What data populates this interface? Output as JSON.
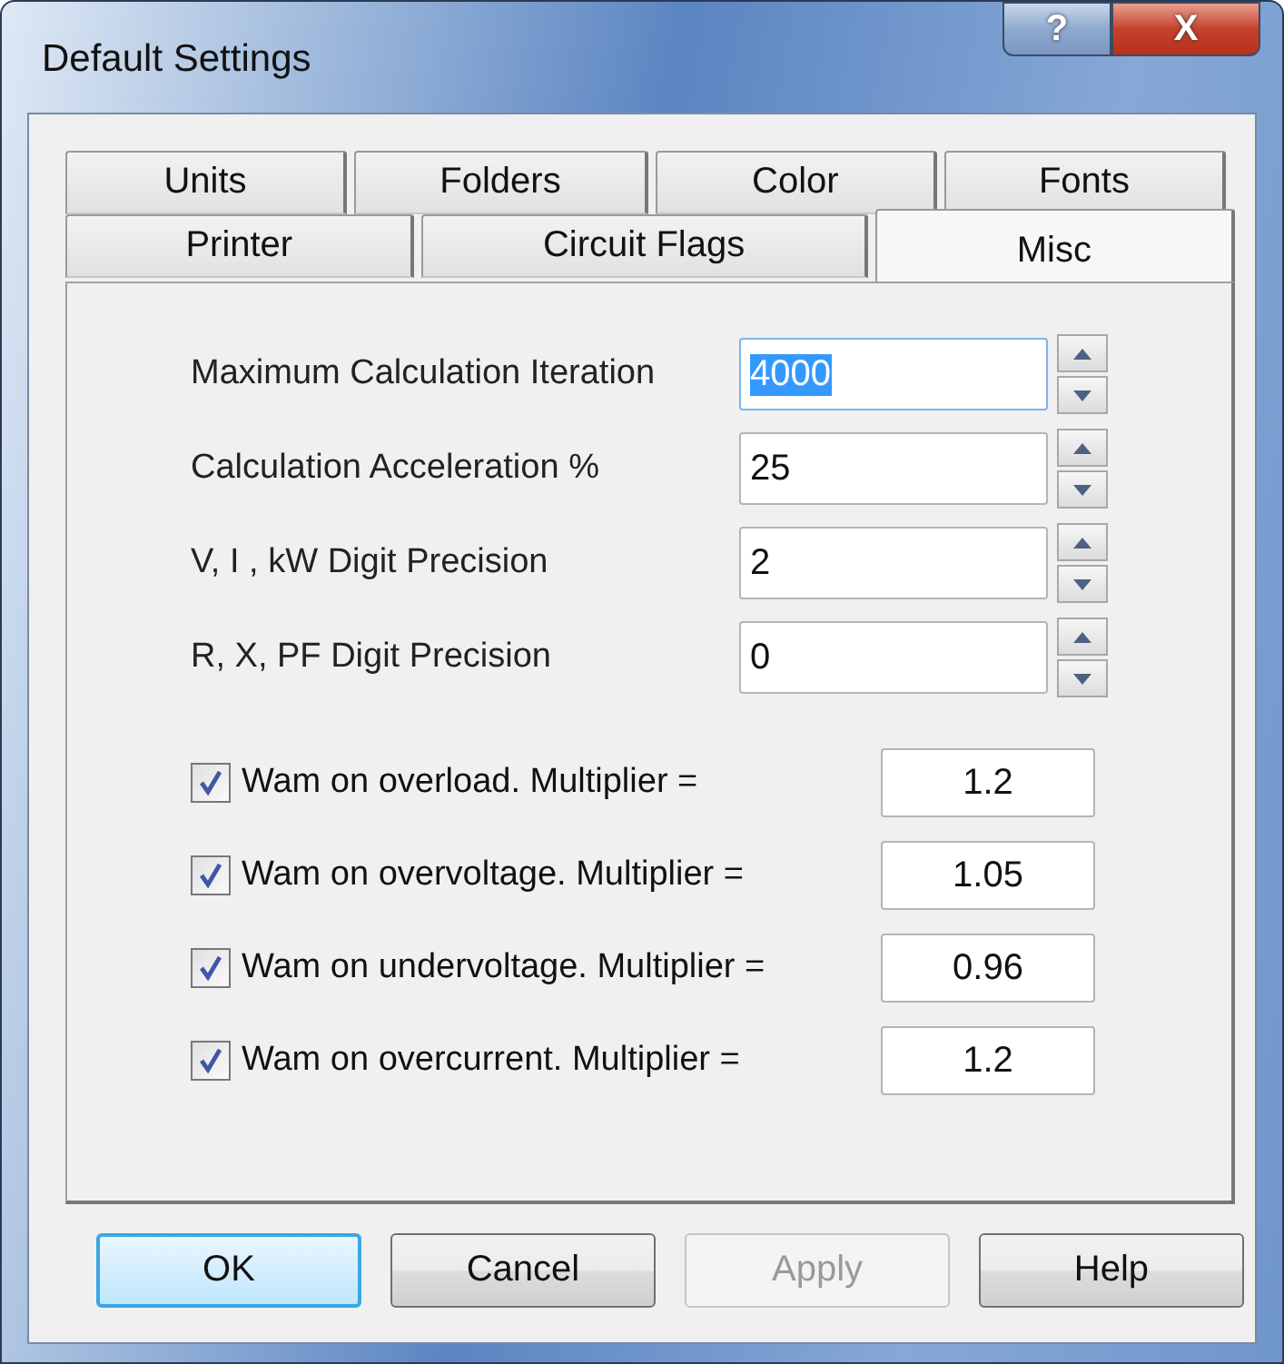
{
  "window": {
    "title": "Default Settings",
    "help_button": "?",
    "close_button": "X"
  },
  "tab_rows": [
    [
      {
        "label": "Units",
        "selected": false
      },
      {
        "label": "Folders",
        "selected": false
      },
      {
        "label": "Color",
        "selected": false
      },
      {
        "label": "Fonts",
        "selected": false
      }
    ],
    [
      {
        "label": "Printer",
        "selected": false
      },
      {
        "label": "Circuit Flags",
        "selected": false
      },
      {
        "label": "Misc",
        "selected": true
      }
    ]
  ],
  "spin_fields": [
    {
      "label": "Maximum Calculation Iteration",
      "value": "4000",
      "text_selected": true
    },
    {
      "label": "Calculation Acceleration %",
      "value": "25",
      "text_selected": false
    },
    {
      "label": "V, I , kW Digit Precision",
      "value": "2",
      "text_selected": false
    },
    {
      "label": "R, X, PF Digit Precision",
      "value": "0",
      "text_selected": false
    }
  ],
  "warnings": [
    {
      "label": "Wam on overload. Multiplier =",
      "checked": true,
      "value": "1.2"
    },
    {
      "label": "Wam on overvoltage. Multiplier =",
      "checked": true,
      "value": "1.05"
    },
    {
      "label": "Wam on undervoltage. Multiplier =",
      "checked": true,
      "value": "0.96"
    },
    {
      "label": "Wam on overcurrent. Multiplier =",
      "checked": true,
      "value": "1.2"
    }
  ],
  "buttons": [
    {
      "label": "OK",
      "default": true,
      "disabled": false
    },
    {
      "label": "Cancel",
      "default": false,
      "disabled": false
    },
    {
      "label": "Apply",
      "default": false,
      "disabled": true
    },
    {
      "label": "Help",
      "default": false,
      "disabled": false
    }
  ]
}
